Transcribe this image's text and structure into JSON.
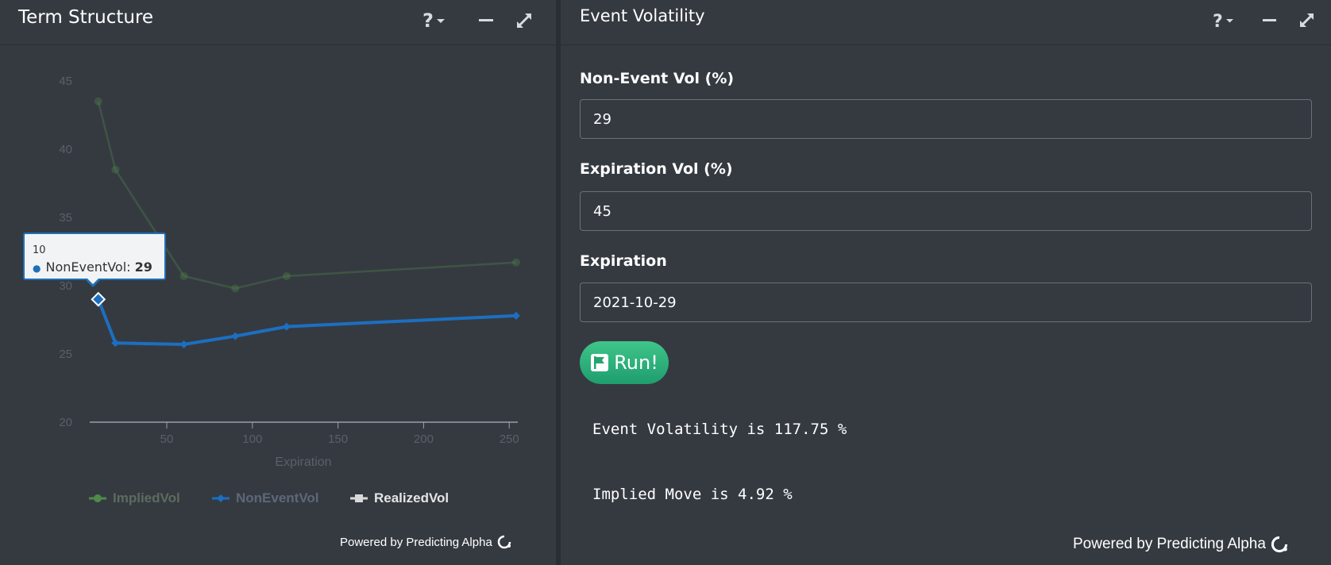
{
  "left_panel": {
    "title": "Term Structure",
    "tools": [
      "help-icon",
      "minimize-icon",
      "expand-icon"
    ],
    "powered_by": "Powered by Predicting Alpha"
  },
  "chart_data": {
    "type": "line",
    "xlabel": "Expiration",
    "ylabel": "",
    "xlim": [
      5,
      255
    ],
    "ylim": [
      20,
      45
    ],
    "x_ticks": [
      50,
      100,
      150,
      200,
      250
    ],
    "y_ticks": [
      20,
      25,
      30,
      35,
      40,
      45
    ],
    "grid": false,
    "legend_position": "bottom",
    "series": [
      {
        "name": "ImpliedVol",
        "color": "#4f8a4a",
        "dimmed": true,
        "x": [
          10,
          20,
          60,
          90,
          120,
          254
        ],
        "y": [
          43.5,
          38.5,
          30.7,
          29.8,
          30.7,
          31.7
        ]
      },
      {
        "name": "NonEventVol",
        "color": "#1c6fc0",
        "dimmed": false,
        "x": [
          10,
          20,
          60,
          90,
          120,
          254
        ],
        "y": [
          29,
          25.8,
          25.7,
          26.3,
          27,
          27.8
        ]
      },
      {
        "name": "RealizedVol",
        "color": "#d9d9d9",
        "dimmed": false,
        "x": [],
        "y": []
      }
    ],
    "tooltip": {
      "x": "10",
      "series": "NonEventVol",
      "value": "29"
    }
  },
  "right_panel": {
    "title": "Event Volatility",
    "tools": [
      "help-icon",
      "minimize-icon",
      "expand-icon"
    ],
    "fields": [
      {
        "label": "Non-Event Vol (%)",
        "value": "29"
      },
      {
        "label": "Expiration Vol (%)",
        "value": "45"
      },
      {
        "label": "Expiration",
        "value": "2021-10-29"
      }
    ],
    "run_label": "Run!",
    "results": [
      "Event Volatility is 117.75 %",
      "Implied Move is 4.92 %"
    ],
    "powered_by": "Powered by Predicting Alpha"
  }
}
